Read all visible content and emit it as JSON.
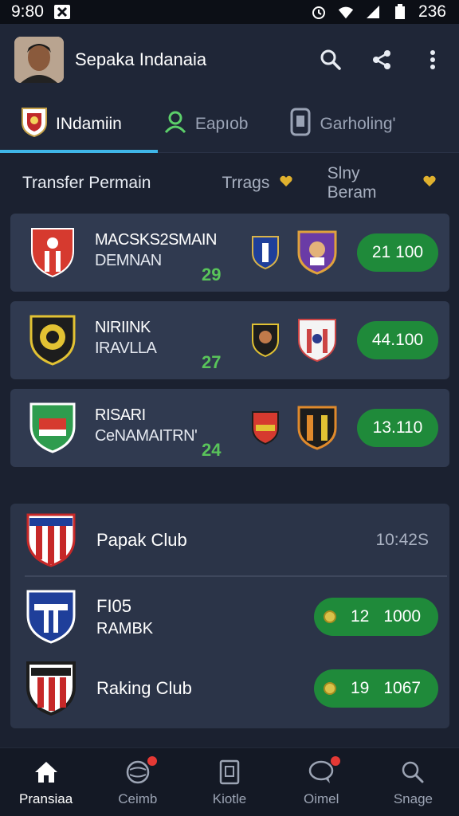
{
  "status_bar": {
    "time": "9:80",
    "battery_text": "236"
  },
  "header": {
    "title": "Sepaka Indanaia"
  },
  "tabs": [
    {
      "label": "INdamiin",
      "icon": "club-crest-icon"
    },
    {
      "label": "Eapıob",
      "icon": "person-icon"
    },
    {
      "label": "Garholing'",
      "icon": "phone-badge-icon"
    }
  ],
  "subtabs": [
    {
      "label": "Transfer Permain"
    },
    {
      "label": "Trrags",
      "icon": "heart-icon"
    },
    {
      "label": "Slny Beram",
      "icon": "heart-icon"
    }
  ],
  "transfers": [
    {
      "name": "MACSKS2SMAIN",
      "sub": "DEMNAN",
      "num": "29",
      "value": "21 100"
    },
    {
      "name": "NIRIINK",
      "sub": "IRAVLLA",
      "num": "27",
      "value": "44.100"
    },
    {
      "name": "RISARI",
      "sub": "CeNAMAITRN'",
      "num": "24",
      "value": "13.110"
    }
  ],
  "clubs": [
    {
      "name": "Papak Club",
      "line2": "",
      "time": "10:42S",
      "pill_a": "",
      "pill_b": ""
    },
    {
      "name": "FI05",
      "line2": "RAMBK",
      "time": "",
      "pill_a": "12",
      "pill_b": "1000"
    },
    {
      "name": "Raking Club",
      "line2": "",
      "time": "",
      "pill_a": "19",
      "pill_b": "1067"
    }
  ],
  "bottom_nav": [
    {
      "label": "Pransiaa",
      "icon": "home-icon",
      "badge": false
    },
    {
      "label": "Ceimb",
      "icon": "ball-icon",
      "badge": true
    },
    {
      "label": "Kiotle",
      "icon": "card-icon",
      "badge": false
    },
    {
      "label": "Oimel",
      "icon": "chat-icon",
      "badge": true
    },
    {
      "label": "Snage",
      "icon": "search-icon",
      "badge": false
    }
  ],
  "colors": {
    "accent": "#3fb6e8",
    "pill_green": "#1f8a3a",
    "number_green": "#59c45a",
    "badge_red": "#e53935"
  }
}
